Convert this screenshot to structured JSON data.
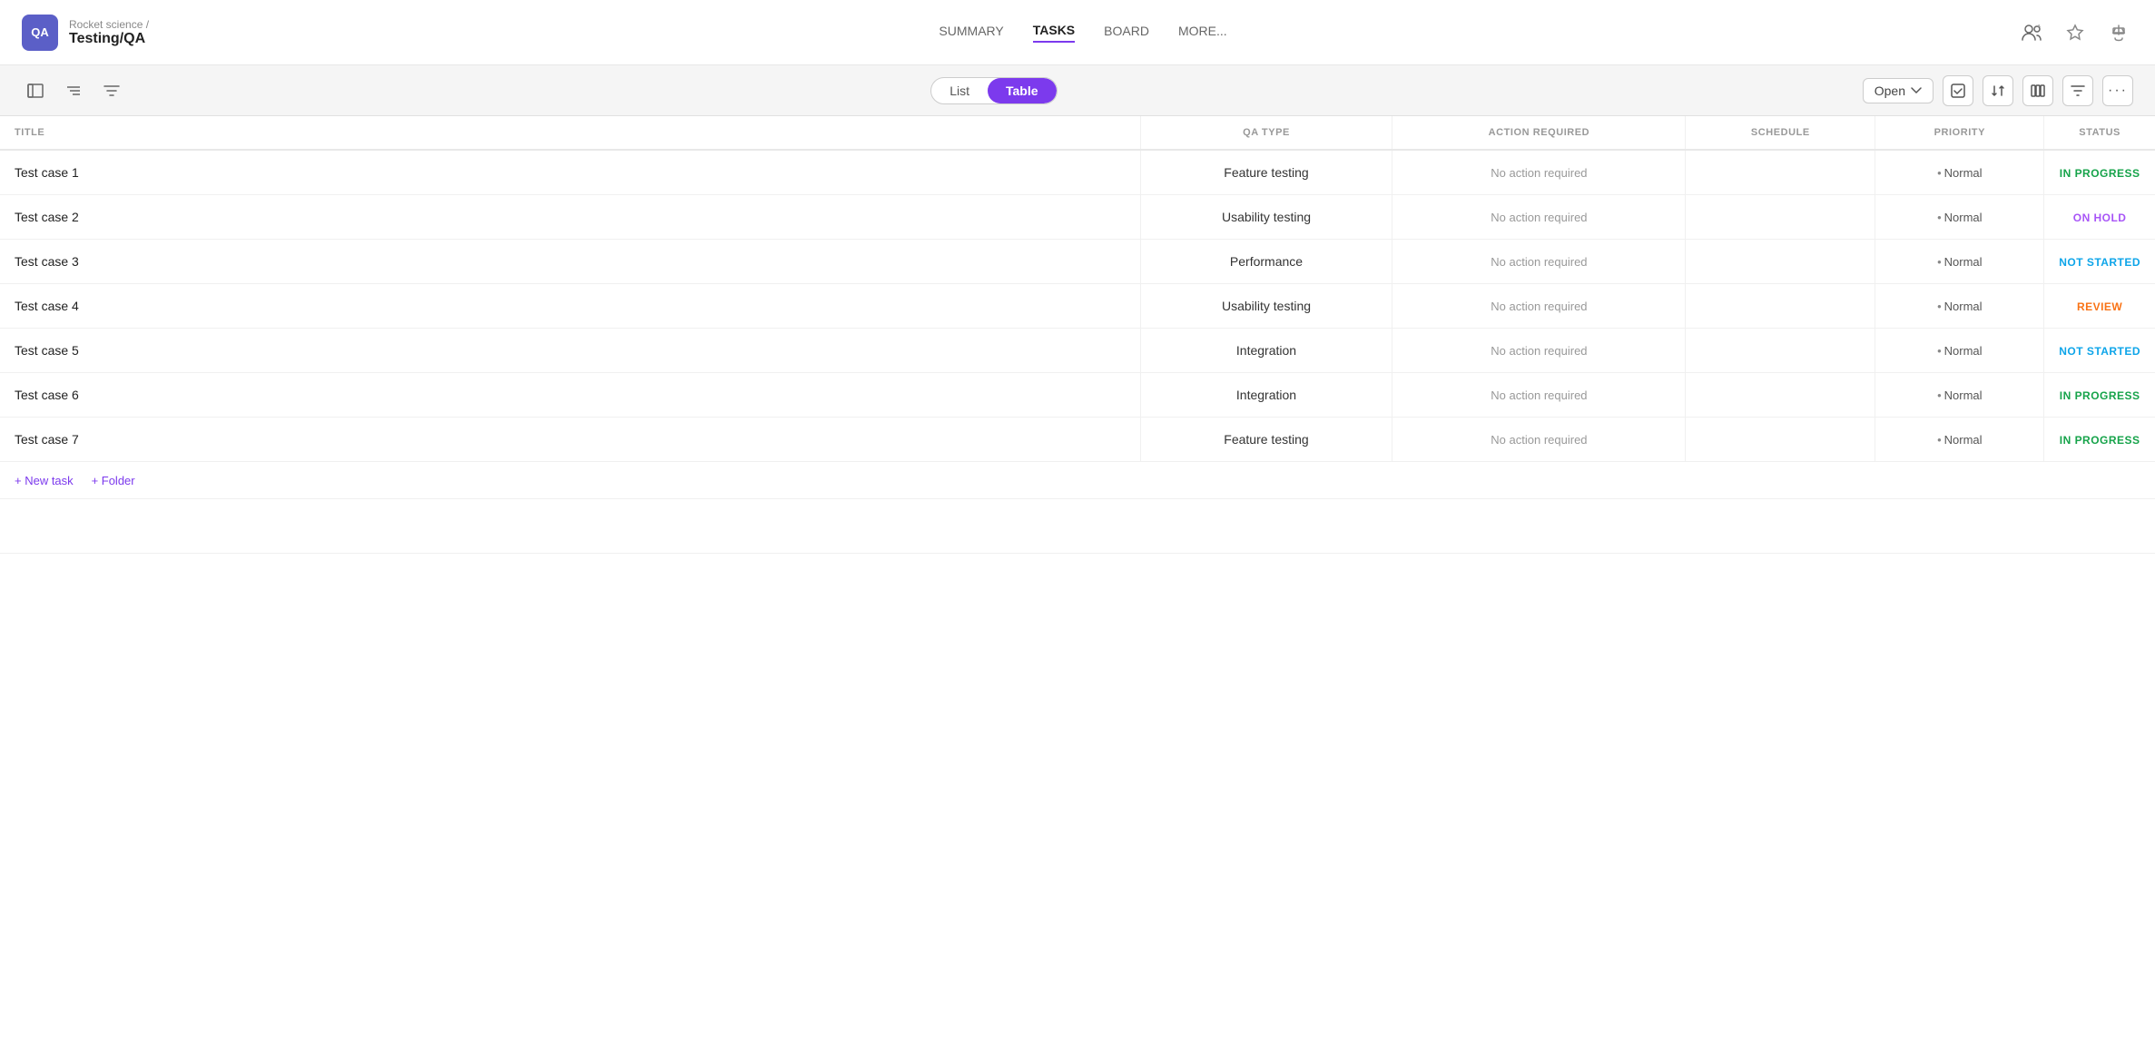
{
  "app": {
    "icon": "QA",
    "breadcrumb_parent": "Rocket science /",
    "breadcrumb_current": "Testing/QA"
  },
  "nav": {
    "links": [
      {
        "label": "SUMMARY",
        "active": false
      },
      {
        "label": "TASKS",
        "active": true
      },
      {
        "label": "BOARD",
        "active": false
      },
      {
        "label": "MORE...",
        "active": false
      }
    ]
  },
  "toolbar": {
    "view_list": "List",
    "view_table": "Table",
    "open_label": "Open",
    "filter_label": "Filter"
  },
  "table": {
    "columns": [
      "TITLE",
      "QA TYPE",
      "ACTION REQUIRED",
      "SCHEDULE",
      "PRIORITY",
      "STATUS"
    ],
    "rows": [
      {
        "title": "Test case 1",
        "qa_type": "Feature testing",
        "action": "No action required",
        "schedule": "",
        "priority": "Normal",
        "status": "IN PROGRESS",
        "status_class": "status-in-progress"
      },
      {
        "title": "Test case 2",
        "qa_type": "Usability testing",
        "action": "No action required",
        "schedule": "",
        "priority": "Normal",
        "status": "ON HOLD",
        "status_class": "status-on-hold"
      },
      {
        "title": "Test case 3",
        "qa_type": "Performance",
        "action": "No action required",
        "schedule": "",
        "priority": "Normal",
        "status": "NOT STARTED",
        "status_class": "status-not-started"
      },
      {
        "title": "Test case 4",
        "qa_type": "Usability testing",
        "action": "No action required",
        "schedule": "",
        "priority": "Normal",
        "status": "REVIEW",
        "status_class": "status-review"
      },
      {
        "title": "Test case 5",
        "qa_type": "Integration",
        "action": "No action required",
        "schedule": "",
        "priority": "Normal",
        "status": "NOT STARTED",
        "status_class": "status-not-started"
      },
      {
        "title": "Test case 6",
        "qa_type": "Integration",
        "action": "No action required",
        "schedule": "",
        "priority": "Normal",
        "status": "IN PROGRESS",
        "status_class": "status-in-progress"
      },
      {
        "title": "Test case 7",
        "qa_type": "Feature testing",
        "action": "No action required",
        "schedule": "",
        "priority": "Normal",
        "status": "IN PROGRESS",
        "status_class": "status-in-progress"
      }
    ],
    "add_task_label": "+ New task",
    "add_folder_label": "+ Folder"
  }
}
